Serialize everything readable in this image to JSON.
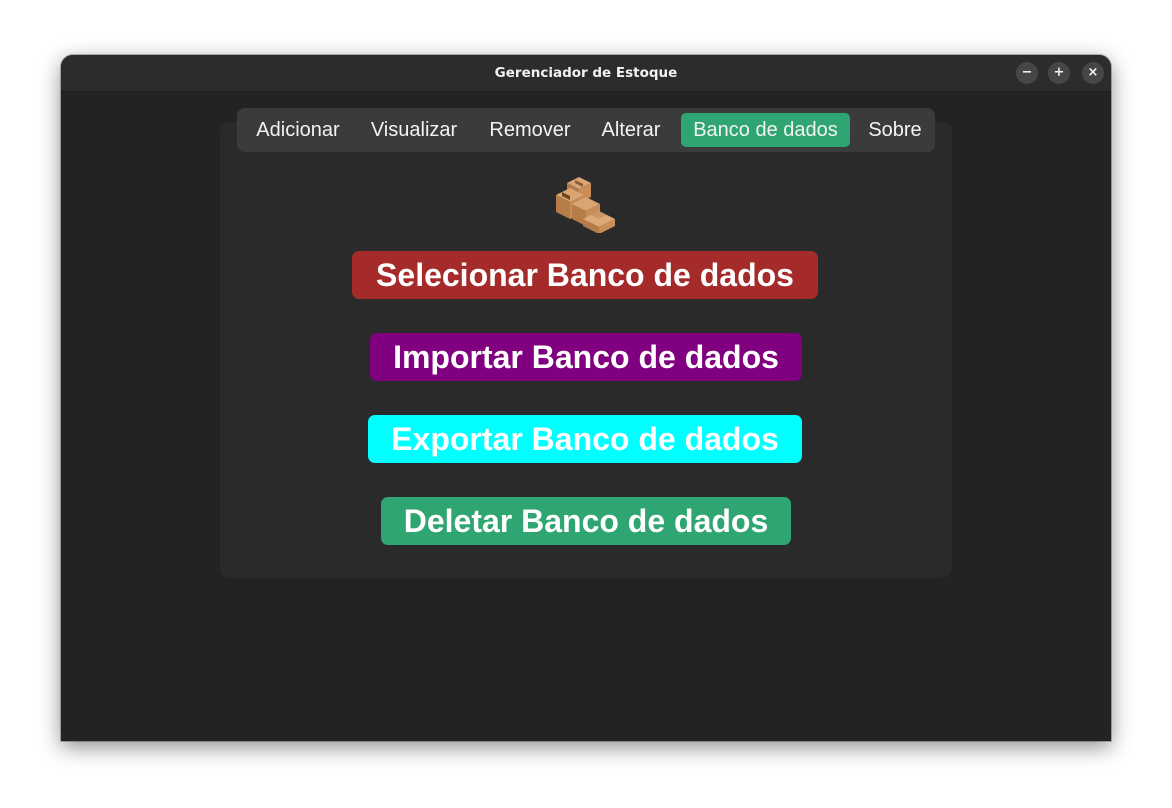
{
  "window": {
    "title": "Gerenciador de Estoque",
    "controls": {
      "minimize": "−",
      "maximize": "+",
      "close": "×"
    }
  },
  "tabs": [
    {
      "label": "Adicionar",
      "active": false
    },
    {
      "label": "Visualizar",
      "active": false
    },
    {
      "label": "Remover",
      "active": false
    },
    {
      "label": "Alterar",
      "active": false
    },
    {
      "label": "Banco de dados",
      "active": true
    },
    {
      "label": "Sobre",
      "active": false
    }
  ],
  "logo": {
    "icon": "package-boxes-icon"
  },
  "actions": {
    "select": {
      "label": "Selecionar Banco de dados",
      "color": "#a52a2a"
    },
    "import": {
      "label": "Importar Banco de dados",
      "color": "#800080"
    },
    "export": {
      "label": "Exportar Banco de dados",
      "color": "#00ffff"
    },
    "delete": {
      "label": "Deletar Banco de dados",
      "color": "#2fa572"
    }
  },
  "colors": {
    "active_tab": "#2fa572",
    "window_bg": "#232323",
    "panel_bg": "#2a2a2a",
    "tabbar_bg": "#3b3b3b"
  }
}
